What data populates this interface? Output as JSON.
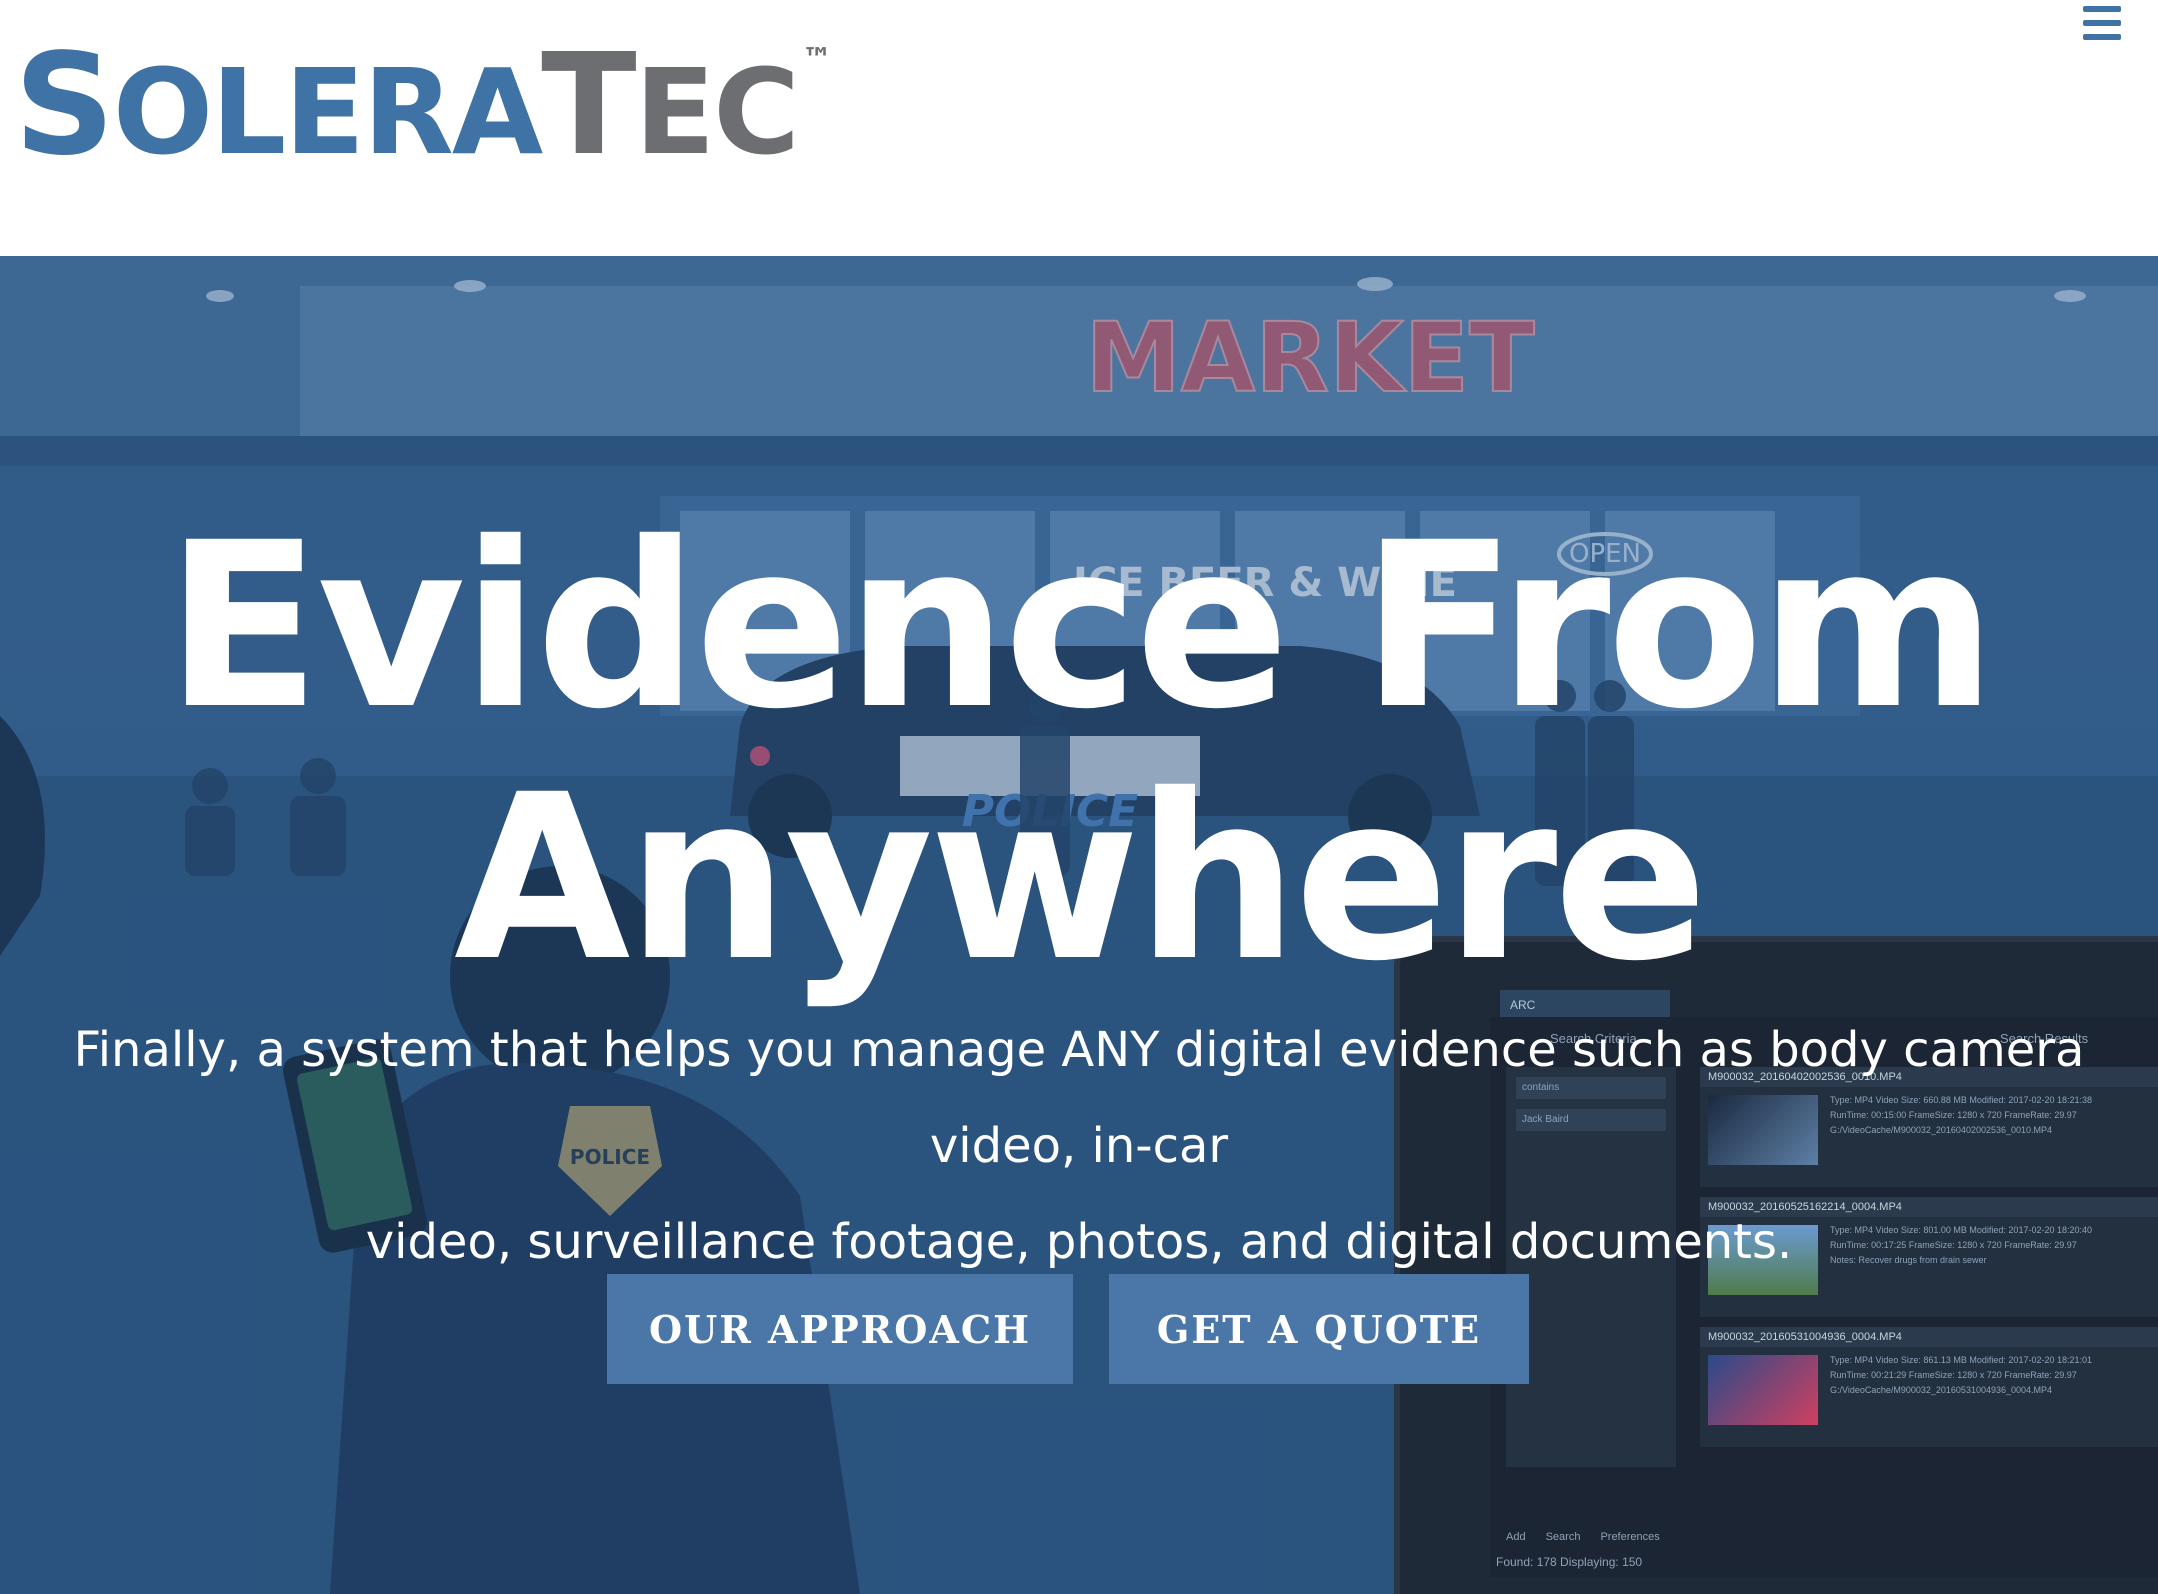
{
  "brand": {
    "logo_text": "SoleraTec",
    "logo_trademark": "™",
    "primary_color": "#3f73a5",
    "secondary_color": "#6d6e71"
  },
  "nav": {
    "menu_icon": "hamburger-menu-icon"
  },
  "hero": {
    "headline_line1": "Evidence From",
    "headline_line2": "Anywhere",
    "subtext_line1": "Finally, a system that helps you manage ANY digital evidence such as body camera video, in-car",
    "subtext_line2": "video, surveillance footage, photos, and digital documents.",
    "buttons": [
      {
        "label": "OUR APPROACH"
      },
      {
        "label": "GET A QUOTE"
      }
    ],
    "button_color": "#4b77a8",
    "background_scene": {
      "store_sign": "MARKET",
      "open_sign": "OPEN",
      "window_sign": "ICE BEER & WINE",
      "car_text": "POLICE",
      "badge_text": "POLICE"
    }
  },
  "app_screenshot": {
    "search_criteria_title": "Search Criteria",
    "search_results_title": "Search Results",
    "criteria_field_1": "contains",
    "criteria_field_2": "Jack Baird",
    "results": [
      {
        "name": "M900032_20160402002536_0010.MP4",
        "meta_1": "Type: MP4 Video   Size: 660.88 MB   Modified: 2017-02-20 18:21:38",
        "meta_2": "RunTime: 00:15:00   FrameSize: 1280 x 720   FrameRate: 29.97",
        "meta_3": "G:/VideoCache/M900032_20160402002536_0010.MP4"
      },
      {
        "name": "M900032_20160525162214_0004.MP4",
        "meta_1": "Type: MP4 Video   Size: 801.00 MB   Modified: 2017-02-20 18:20:40",
        "meta_2": "RunTime: 00:17:25   FrameSize: 1280 x 720   FrameRate: 29.97",
        "meta_3": "Notes: Recover drugs from drain sewer"
      },
      {
        "name": "M900032_20160531004936_0004.MP4",
        "meta_1": "Type: MP4 Video   Size: 861.13 MB   Modified: 2017-02-20 18:21:01",
        "meta_2": "RunTime: 00:21:29   FrameSize: 1280 x 720   FrameRate: 29.97",
        "meta_3": "G:/VideoCache/M900032_20160531004936_0004.MP4"
      }
    ],
    "add_label": "Add",
    "search_label": "Search",
    "preferences_label": "Preferences",
    "footer": "Found: 178  Displaying: 150"
  }
}
